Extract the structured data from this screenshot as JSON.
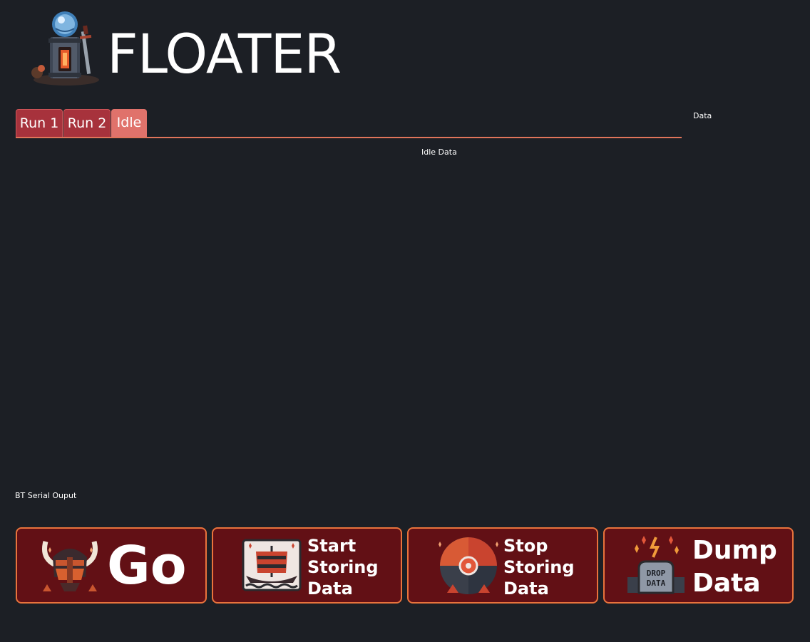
{
  "header": {
    "title": "FLOATER",
    "logo_icon": "tower-crystal-logo-icon"
  },
  "tabs": [
    {
      "label": "Run 1",
      "active": false
    },
    {
      "label": "Run 2",
      "active": false
    },
    {
      "label": "Idle",
      "active": true
    }
  ],
  "panels": {
    "data_label": "Data",
    "idle_data_label": "Idle Data",
    "serial_label": "BT Serial Ouput"
  },
  "actions": {
    "go": {
      "label": "Go",
      "icon": "viking-helmet-icon"
    },
    "start": {
      "label": "Start\nStoring\nData",
      "icon": "viking-ship-icon"
    },
    "stop": {
      "label": "Stop\nStoring\nData",
      "icon": "shield-wheel-icon"
    },
    "dump": {
      "label": "Dump\nData",
      "icon": "drop-data-tombstone-icon",
      "icon_text": "DROP DATA"
    }
  },
  "colors": {
    "background": "#1c1f25",
    "tab_inactive": "#a7323c",
    "tab_active": "#e0726b",
    "accent_line": "#e0745a",
    "button_fill": "#621015",
    "button_border": "#e9733c"
  }
}
